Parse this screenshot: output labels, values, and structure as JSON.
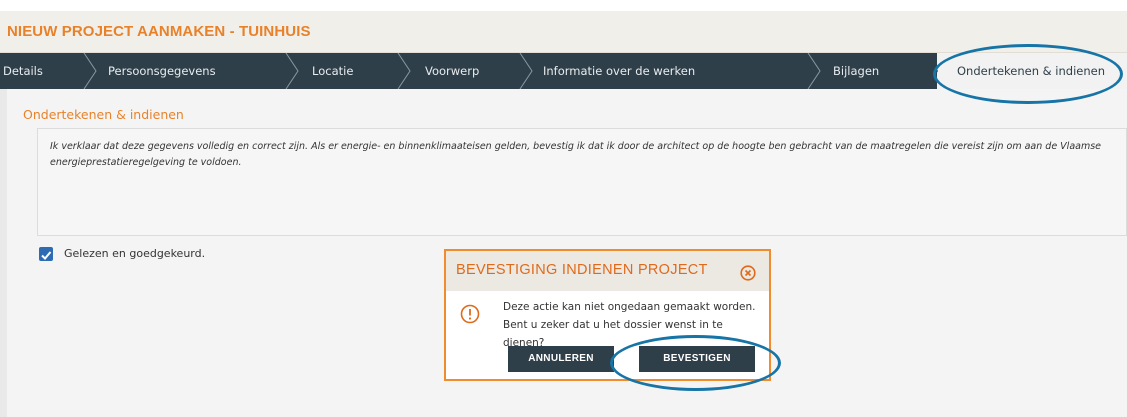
{
  "page": {
    "title": "NIEUW PROJECT AANMAKEN - TUINHUIS"
  },
  "stepper": {
    "steps": [
      {
        "label": "Details"
      },
      {
        "label": "Persoonsgegevens"
      },
      {
        "label": "Locatie"
      },
      {
        "label": "Voorwerp"
      },
      {
        "label": "Informatie over de werken"
      },
      {
        "label": "Bijlagen"
      },
      {
        "label": "Ondertekenen & indienen",
        "active": true
      }
    ]
  },
  "section": {
    "title": "Ondertekenen & indienen",
    "declaration": "Ik verklaar dat deze gegevens volledig en correct zijn. Als er energie- en binnenklimaateisen gelden, bevestig ik dat ik door de architect op de hoogte ben gebracht van de maatregelen die vereist zijn om aan de Vlaamse energieprestatieregelgeving te voldoen.",
    "checkbox_label": "Gelezen en goedgekeurd.",
    "checkbox_checked": true
  },
  "modal": {
    "title": "BEVESTIGING INDIENEN PROJECT",
    "message_line1": "Deze actie kan niet ongedaan gemaakt worden.",
    "message_line2": "Bent u zeker dat u het dossier wenst in te dienen?",
    "cancel_label": "ANNULEREN",
    "confirm_label": "BEVESTIGEN"
  },
  "colors": {
    "accent_orange": "#e8822a",
    "nav_dark": "#2f3f49",
    "highlight_blue": "#1674a6",
    "checkbox_blue": "#2d6cb3"
  }
}
